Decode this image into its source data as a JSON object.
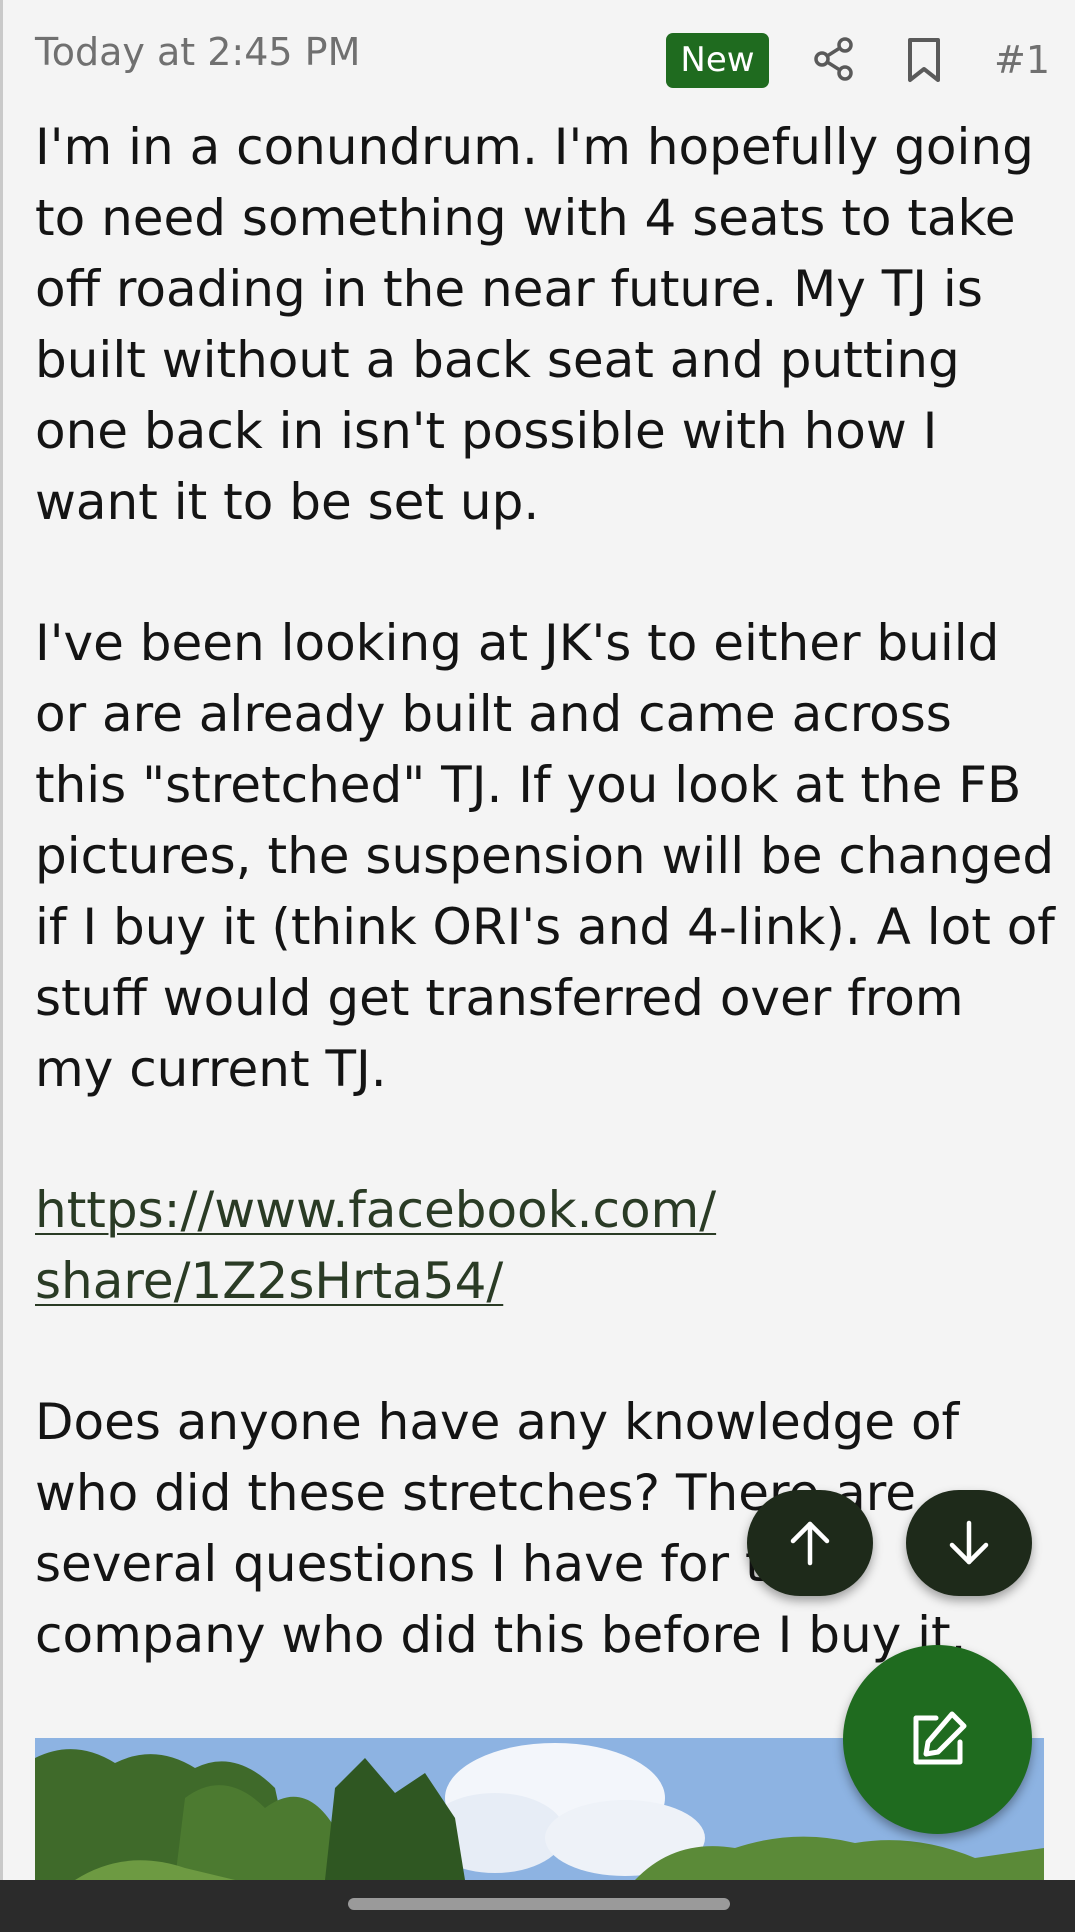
{
  "post": {
    "timestamp": "Today at 2:45 PM",
    "badge": "New",
    "number": "#1",
    "paragraph1": "I'm in a conundrum. I'm hopefully going to need something with 4 seats to take off roading in the near future. My TJ is built without a back seat and putting one back in isn't possible with how I want it to be set up.",
    "paragraph2": "I've been looking at JK's to either build or are already built and came across this \"stretched\" TJ. If you look at the FB pictures, the suspension will be changed if I buy it (think ORI's and 4-link). A lot of stuff would get transferred over from my current TJ.",
    "link": "https://www.facebook.com/share/1Z2sHrta54/",
    "paragraph3": "Does anyone have any knowledge of who did these stretches? There are several questions I have for the company who did this before I buy it."
  },
  "icons": {
    "share": "share-icon",
    "bookmark": "bookmark-icon",
    "scroll_up": "arrow-up-icon",
    "scroll_down": "arrow-down-icon",
    "compose": "compose-icon"
  },
  "colors": {
    "accent_green": "#1f6b1f",
    "fab_dark": "#1e2a1a",
    "background": "#f4f4f4"
  }
}
